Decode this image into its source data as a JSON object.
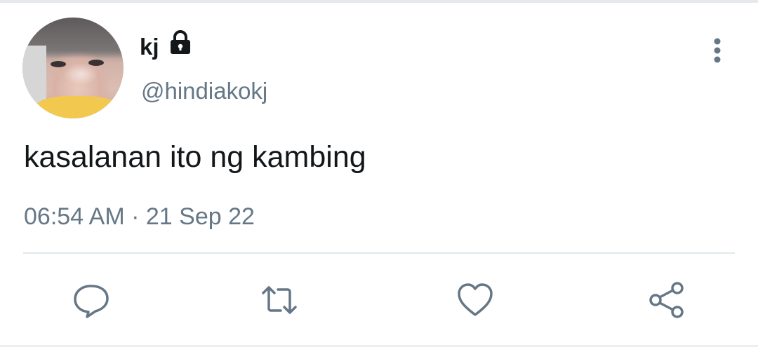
{
  "tweet": {
    "display_name": "kj",
    "handle": "@hindiakokj",
    "text": "kasalanan ito ng kambing",
    "time": "06:54 AM",
    "separator": " · ",
    "date": "21 Sep 22"
  },
  "icons": {
    "verified_lock": "lock-icon",
    "more": "more-vertical-icon",
    "actions": [
      "reply-icon",
      "retweet-icon",
      "like-icon",
      "share-icon"
    ]
  },
  "colors": {
    "text": "#14171a",
    "secondary": "#657786",
    "divider": "#e1e8ed"
  }
}
